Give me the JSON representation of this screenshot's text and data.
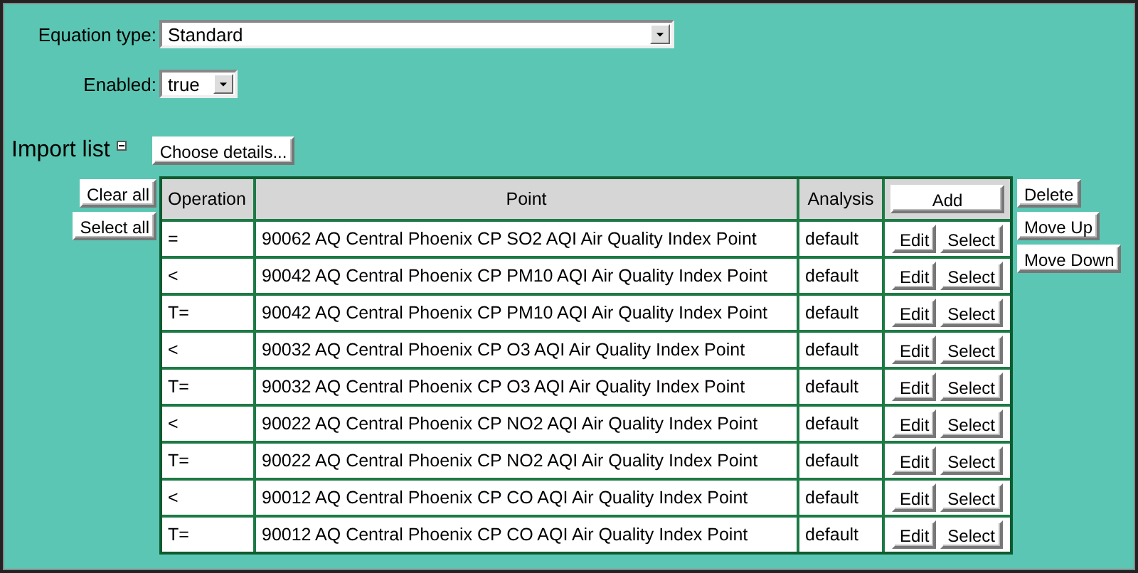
{
  "equation_type": {
    "label": "Equation type:",
    "value": "Standard"
  },
  "enabled": {
    "label": "Enabled:",
    "value": "true"
  },
  "import_list": {
    "title": "Import list",
    "choose_button": "Choose details..."
  },
  "left_buttons": [
    "Clear all",
    "Select all"
  ],
  "table": {
    "columns": [
      "Operation",
      "Point",
      "Analysis"
    ],
    "add_button": "Add",
    "rows": [
      {
        "operation": "=",
        "point": "90062 AQ Central Phoenix CP SO2 AQI Air Quality Index Point",
        "analysis": "default",
        "buttons": [
          "Edit",
          "Select"
        ]
      },
      {
        "operation": "<",
        "point": "90042 AQ Central Phoenix CP PM10 AQI Air Quality Index Point",
        "analysis": "default",
        "buttons": [
          "Edit",
          "Select"
        ]
      },
      {
        "operation": "T=",
        "point": "90042 AQ Central Phoenix CP PM10 AQI Air Quality Index Point",
        "analysis": "default",
        "buttons": [
          "Edit",
          "Select"
        ]
      },
      {
        "operation": "<",
        "point": "90032 AQ Central Phoenix CP O3 AQI Air Quality Index Point",
        "analysis": "default",
        "buttons": [
          "Edit",
          "Select"
        ]
      },
      {
        "operation": "T=",
        "point": "90032 AQ Central Phoenix CP O3 AQI Air Quality Index Point",
        "analysis": "default",
        "buttons": [
          "Edit",
          "Select"
        ]
      },
      {
        "operation": "<",
        "point": "90022 AQ Central Phoenix CP NO2 AQI Air Quality Index Point",
        "analysis": "default",
        "buttons": [
          "Edit",
          "Select"
        ]
      },
      {
        "operation": "T=",
        "point": "90022 AQ Central Phoenix CP NO2 AQI Air Quality Index Point",
        "analysis": "default",
        "buttons": [
          "Edit",
          "Select"
        ]
      },
      {
        "operation": "<",
        "point": "90012 AQ Central Phoenix CP CO AQI Air Quality Index Point",
        "analysis": "default",
        "buttons": [
          "Edit",
          "Select"
        ]
      },
      {
        "operation": "T=",
        "point": "90012 AQ Central Phoenix CP CO AQI Air Quality Index Point",
        "analysis": "default",
        "buttons": [
          "Edit",
          "Select"
        ]
      }
    ]
  },
  "right_buttons": [
    "Delete",
    "Move Up",
    "Move Down"
  ]
}
